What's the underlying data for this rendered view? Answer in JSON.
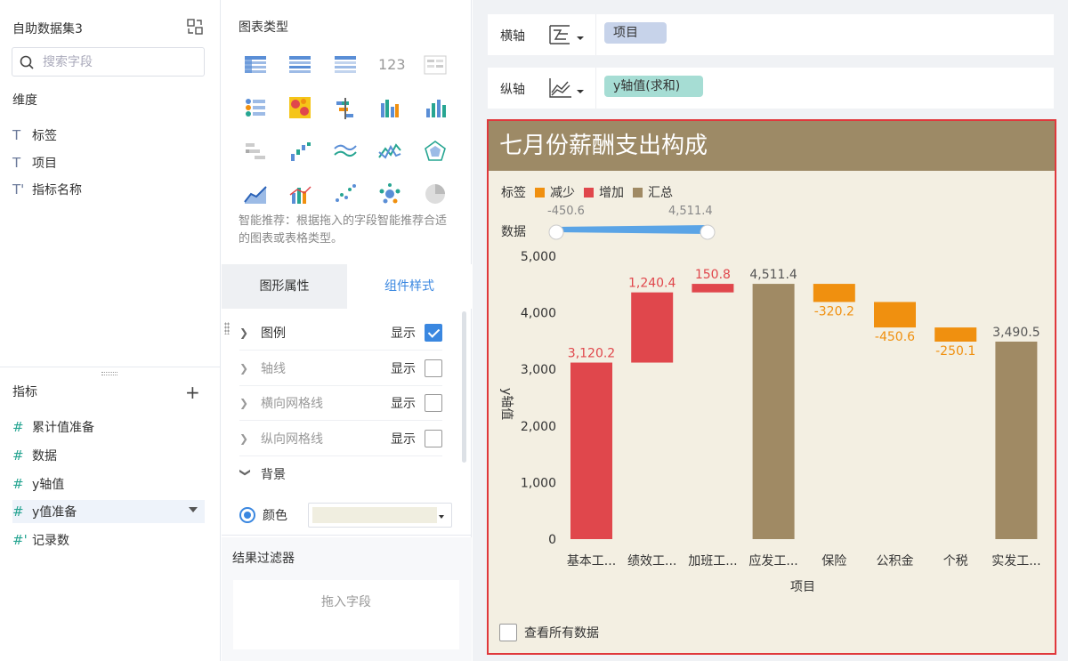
{
  "dataset": {
    "title": "自助数据集3",
    "search_placeholder": "搜索字段"
  },
  "dimensions": {
    "header": "维度",
    "items": [
      {
        "icon": "T",
        "label": "标签"
      },
      {
        "icon": "T",
        "label": "项目"
      },
      {
        "icon": "T'",
        "label": "指标名称"
      }
    ]
  },
  "measures": {
    "header": "指标",
    "items": [
      {
        "icon": "#",
        "label": "累计值准备"
      },
      {
        "icon": "#",
        "label": "数据"
      },
      {
        "icon": "#",
        "label": "y轴值"
      },
      {
        "icon": "#",
        "label": "y值准备"
      },
      {
        "icon": "#'",
        "label": "记录数"
      }
    ]
  },
  "chart_type_panel": {
    "title": "图表类型",
    "hint": "智能推荐：根据拖入的字段智能推荐合适的图表或表格类型。",
    "number_icon_text": "123"
  },
  "tabs": {
    "graphic": "图形属性",
    "component": "组件样式"
  },
  "component_props": [
    {
      "label": "图例",
      "show": "显示",
      "checked": true,
      "disabled": false
    },
    {
      "label": "轴线",
      "show": "显示",
      "checked": false,
      "disabled": true
    },
    {
      "label": "横向网格线",
      "show": "显示",
      "checked": false,
      "disabled": true
    },
    {
      "label": "纵向网格线",
      "show": "显示",
      "checked": false,
      "disabled": true
    }
  ],
  "background": {
    "label": "背景",
    "color_label": "颜色",
    "color_value": "#f0eee0"
  },
  "result_filter": {
    "title": "结果过滤器",
    "placeholder": "拖入字段"
  },
  "x_axis": {
    "label": "横轴",
    "field": "项目"
  },
  "y_axis": {
    "label": "纵轴",
    "field": "y轴值(求和)"
  },
  "colors": {
    "decrease": "#f0900f",
    "increase": "#e0474c",
    "total": "#a08a64",
    "title_bg": "#9d8a66",
    "chart_bg": "#f3efe2"
  },
  "chart_data": {
    "type": "bar",
    "subtype": "waterfall",
    "title": "七月份薪酬支出构成",
    "legend_title": "标签",
    "legend": [
      "减少",
      "增加",
      "汇总"
    ],
    "range_label": "数据",
    "range": {
      "min": "-450.6",
      "max": "4,511.4"
    },
    "xlabel": "项目",
    "ylabel": "y轴值",
    "ylim": [
      0,
      5000
    ],
    "yticks": [
      "0",
      "1,000",
      "2,000",
      "3,000",
      "4,000",
      "5,000"
    ],
    "categories": [
      "基本工...",
      "绩效工...",
      "加班工...",
      "应发工...",
      "保险",
      "公积金",
      "个税",
      "实发工..."
    ],
    "bars": [
      {
        "start": 0,
        "end": 3120.2,
        "kind": "increase",
        "label": "3,120.2"
      },
      {
        "start": 3120.2,
        "end": 4360.6,
        "kind": "increase",
        "label": "1,240.4"
      },
      {
        "start": 4360.6,
        "end": 4511.4,
        "kind": "increase",
        "label": "150.8"
      },
      {
        "start": 0,
        "end": 4511.4,
        "kind": "total",
        "label": "4,511.4"
      },
      {
        "start": 4511.4,
        "end": 4191.2,
        "kind": "decrease",
        "label": "-320.2"
      },
      {
        "start": 4191.2,
        "end": 3740.6,
        "kind": "decrease",
        "label": "-450.6"
      },
      {
        "start": 3740.6,
        "end": 3490.5,
        "kind": "decrease",
        "label": "-250.1"
      },
      {
        "start": 0,
        "end": 3490.5,
        "kind": "total",
        "label": "3,490.5"
      }
    ],
    "grid": false,
    "legend_position": "top-left"
  },
  "footer": {
    "view_all": "查看所有数据"
  }
}
